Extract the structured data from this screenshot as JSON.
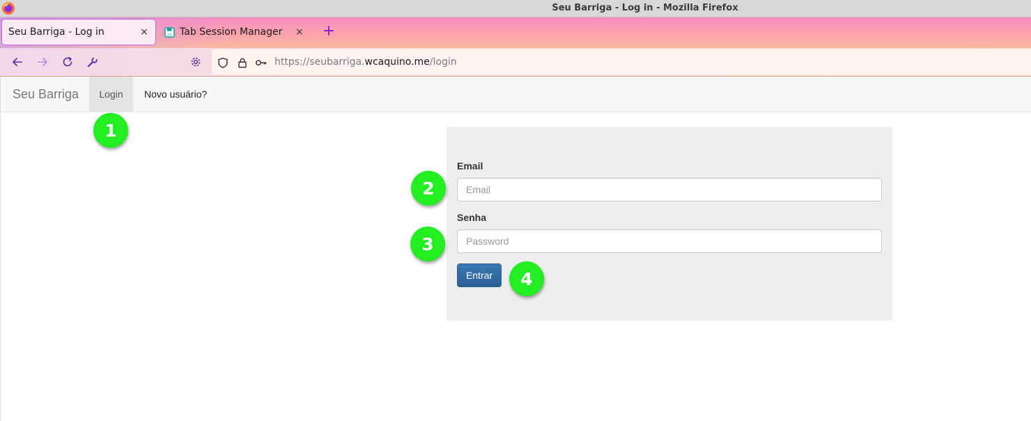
{
  "window": {
    "title": "Seu Barriga - Log in - Mozilla Firefox"
  },
  "tabs": [
    {
      "label": "Seu Barriga - Log in",
      "active": true
    },
    {
      "label": "Tab Session Manager",
      "active": false
    }
  ],
  "toolbar": {
    "new_tab_symbol": "+",
    "close_symbol": "×"
  },
  "urlbar": {
    "scheme": "https://",
    "subdomain": "seubarriga.",
    "host": "wcaquino.me",
    "path": "/login"
  },
  "site": {
    "brand": "Seu Barriga",
    "nav": {
      "login": "Login",
      "new_user": "Novo usuário?"
    }
  },
  "form": {
    "email_label": "Email",
    "email_placeholder": "Email",
    "email_value": "",
    "password_label": "Senha",
    "password_placeholder": "Password",
    "password_value": "",
    "submit_label": "Entrar"
  },
  "annotations": [
    "1",
    "2",
    "3",
    "4"
  ],
  "colors": {
    "annotation_green": "#22ee22",
    "button_blue": "#2b5f96",
    "tab_accent": "#b86adf"
  },
  "icons": {
    "browser": "firefox-logo-icon",
    "back": "arrow-left-icon",
    "forward": "arrow-right-icon",
    "reload": "reload-icon",
    "extension": "wrench-icon",
    "settings": "gear-icon",
    "tracking": "shield-icon",
    "secure": "lock-icon",
    "password": "key-icon"
  }
}
